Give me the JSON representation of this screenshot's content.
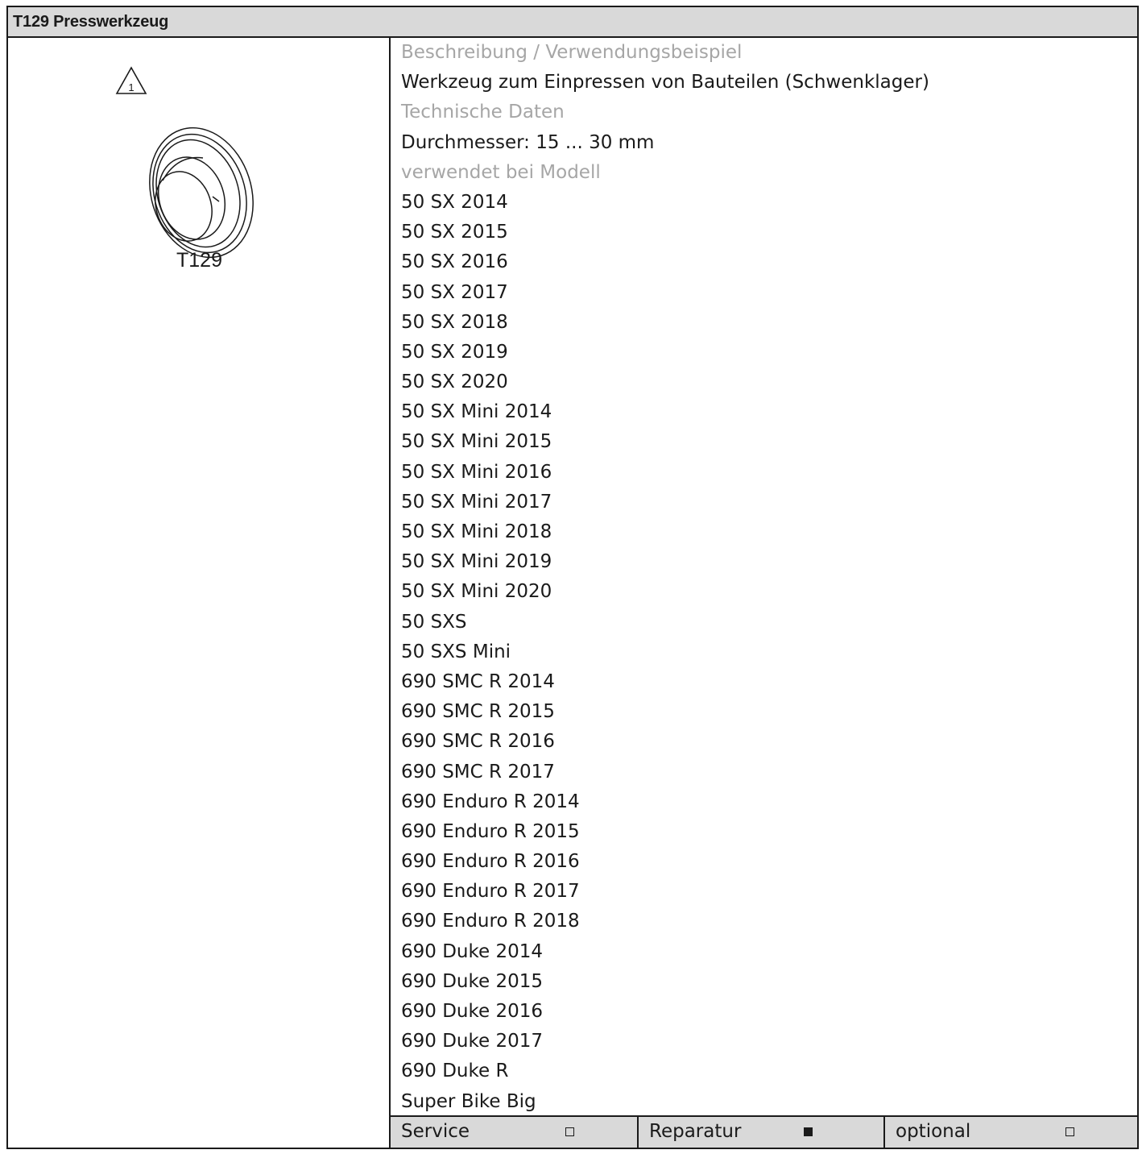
{
  "header": {
    "title": "T129 Presswerkzeug"
  },
  "left": {
    "tool_label": "T129",
    "warning_number": "1"
  },
  "right": {
    "lines": [
      {
        "text": "Beschreibung / Verwendungsbeispiel",
        "muted": true
      },
      {
        "text": "Werkzeug zum Einpressen von Bauteilen (Schwenklager)",
        "muted": false
      },
      {
        "text": "Technische Daten",
        "muted": true
      },
      {
        "text": "Durchmesser: 15 ... 30 mm",
        "muted": false
      },
      {
        "text": "verwendet bei Modell",
        "muted": true
      },
      {
        "text": "50 SX 2014",
        "muted": false
      },
      {
        "text": "50 SX 2015",
        "muted": false
      },
      {
        "text": "50 SX 2016",
        "muted": false
      },
      {
        "text": "50 SX 2017",
        "muted": false
      },
      {
        "text": "50 SX 2018",
        "muted": false
      },
      {
        "text": "50 SX 2019",
        "muted": false
      },
      {
        "text": "50 SX 2020",
        "muted": false
      },
      {
        "text": "50 SX Mini 2014",
        "muted": false
      },
      {
        "text": "50 SX Mini 2015",
        "muted": false
      },
      {
        "text": "50 SX Mini 2016",
        "muted": false
      },
      {
        "text": "50 SX Mini 2017",
        "muted": false
      },
      {
        "text": "50 SX Mini 2018",
        "muted": false
      },
      {
        "text": "50 SX Mini 2019",
        "muted": false
      },
      {
        "text": "50 SX Mini 2020",
        "muted": false
      },
      {
        "text": "50 SXS",
        "muted": false
      },
      {
        "text": "50 SXS Mini",
        "muted": false
      },
      {
        "text": "690 SMC R 2014",
        "muted": false
      },
      {
        "text": "690 SMC R 2015",
        "muted": false
      },
      {
        "text": "690 SMC R 2016",
        "muted": false
      },
      {
        "text": "690 SMC R 2017",
        "muted": false
      },
      {
        "text": "690 Enduro R 2014",
        "muted": false
      },
      {
        "text": "690 Enduro R 2015",
        "muted": false
      },
      {
        "text": "690 Enduro R 2016",
        "muted": false
      },
      {
        "text": "690 Enduro R 2017",
        "muted": false
      },
      {
        "text": "690 Enduro R 2018",
        "muted": false
      },
      {
        "text": "690 Duke 2014",
        "muted": false
      },
      {
        "text": "690 Duke 2015",
        "muted": false
      },
      {
        "text": "690 Duke 2016",
        "muted": false
      },
      {
        "text": "690 Duke 2017",
        "muted": false
      },
      {
        "text": "690 Duke R",
        "muted": false
      },
      {
        "text": "Super Bike Big",
        "muted": false
      }
    ]
  },
  "footer": {
    "service": {
      "label": "Service",
      "checked": false
    },
    "reparatur": {
      "label": "Reparatur",
      "checked": true
    },
    "optional": {
      "label": "optional",
      "checked": false
    }
  },
  "colors": {
    "muted_text": "#a6a6a6",
    "header_bg": "#d9d9d9",
    "footer_bg": "#d9d9d9"
  }
}
